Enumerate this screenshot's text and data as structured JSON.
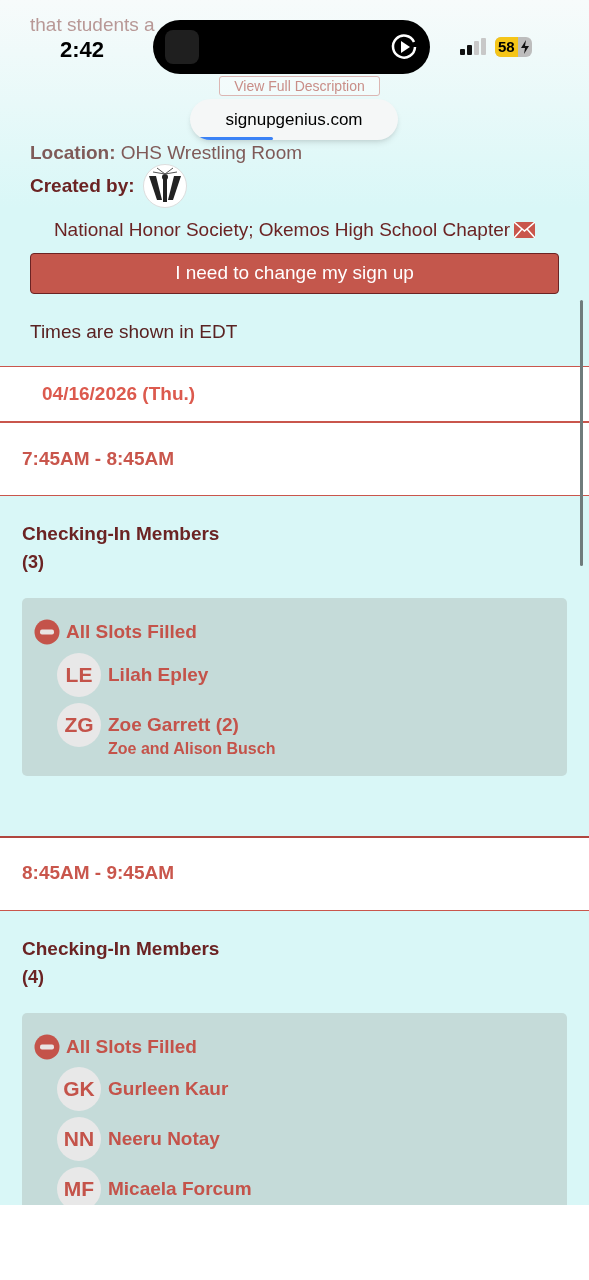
{
  "status_bar": {
    "time": "2:42",
    "battery": "58"
  },
  "url_pill": {
    "domain": "signupgenius.com",
    "level": 0.4
  },
  "description": {
    "text": "that students a",
    "button": "View Full Description"
  },
  "location": {
    "label": "Location:",
    "value": "OHS Wrestling Room"
  },
  "created_by": {
    "label": "Created by:",
    "organization": "National Honor Society; Okemos High School Chapter"
  },
  "change_button": "I need to change my sign up",
  "timezone_note": "Times are shown in EDT",
  "date": "04/16/2026 (Thu.)",
  "slots": [
    {
      "time": "7:45AM - 8:45AM",
      "title": "Checking-In Members",
      "count": "(3)",
      "status": "All Slots Filled",
      "people": [
        {
          "initials": "LE",
          "name": "Lilah Epley"
        },
        {
          "initials": "ZG",
          "name": "Zoe Garrett (2)",
          "note": "Zoe and Alison Busch"
        }
      ]
    },
    {
      "time": "8:45AM - 9:45AM",
      "title": "Checking-In Members",
      "count": "(4)",
      "status": "All Slots Filled",
      "people": [
        {
          "initials": "GK",
          "name": "Gurleen Kaur"
        },
        {
          "initials": "NN",
          "name": "Neeru Notay"
        },
        {
          "initials": "MF",
          "name": "Micaela Forcum"
        }
      ]
    }
  ]
}
